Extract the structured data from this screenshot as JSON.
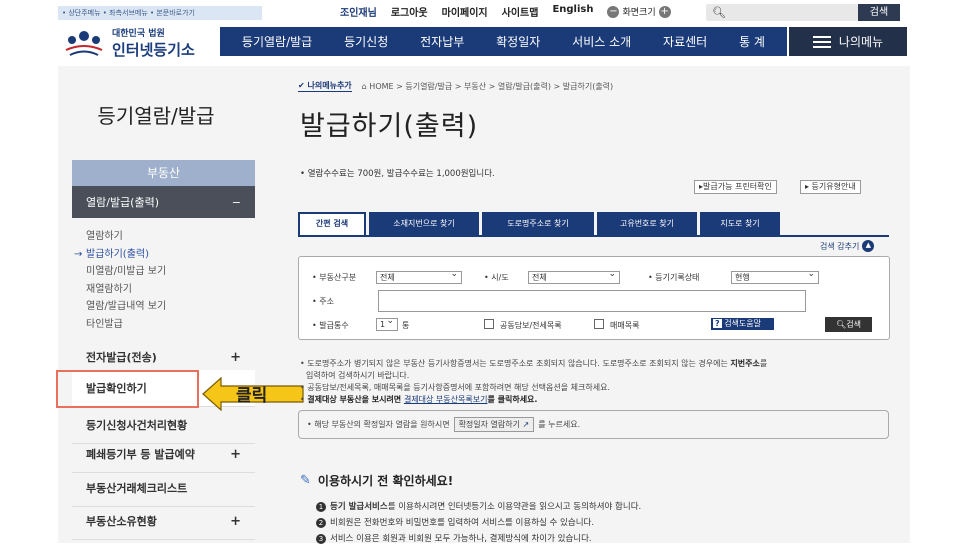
{
  "util": {
    "skip": "• 상단주메뉴 • 좌측서브메뉴 • 본문바로가기"
  },
  "toplinks": {
    "member": "조인재님",
    "logout": "로그아웃",
    "mypage": "마이페이지",
    "sitemap": "사이트맵",
    "english": "English",
    "zoom": "화면크기",
    "zoom_minus": "−",
    "zoom_plus": "+"
  },
  "search": {
    "button": "검색"
  },
  "logo": {
    "org": "대한민국 법원",
    "name": "인터넷등기소"
  },
  "gnb": [
    "등기열람/발급",
    "등기신청",
    "전자납부",
    "확정일자",
    "서비스 소개",
    "자료센터",
    "통 계"
  ],
  "mymenu": "나의메뉴",
  "left": {
    "title": "등기열람/발급",
    "section": "부동산",
    "active": "열람/발급(출력)",
    "active_toggle": "−",
    "subs": [
      "열람하기",
      "발급하기(출력)",
      "미열람/미발급 보기",
      "재열람하기",
      "열람/발급내역 보기",
      "타인발급"
    ],
    "items": [
      {
        "label": "전자발급(전송)",
        "plus": "+"
      },
      {
        "label": "발급확인하기",
        "plus": ""
      },
      {
        "label": "등기신청사건처리현황",
        "plus": ""
      },
      {
        "label": "폐쇄등기부 등 발급예약",
        "plus": "+"
      },
      {
        "label": "부동산거래체크리스트",
        "plus": ""
      },
      {
        "label": "부동산소유현황",
        "plus": "+"
      }
    ]
  },
  "click_label": "클릭",
  "crumb": {
    "fav": "나의메뉴추가",
    "path": "HOME > 등기열람/발급 > 부동산 > 열람/발급(출력) > 발급하기(출력)"
  },
  "page_title": "발급하기(출력)",
  "notice1": "• 열람수수료는 700원, 발급수수료는 1,000원입니다.",
  "btn_printer": "▸발급가능 프린터확인",
  "btn_type": "▸ 등기유형안내",
  "tabs": [
    "간편 검색",
    "소재지번으로 찾기",
    "도로명주소로 찾기",
    "고유번호로 찾기",
    "지도로 찾기"
  ],
  "collapse": "검색 감추기",
  "form": {
    "type_label": "• 부동산구분",
    "type_value": "전체",
    "sido_label": "• 시/도",
    "sido_value": "전체",
    "status_label": "• 등기기록상태",
    "status_value": "현행",
    "addr_label": "• 주소",
    "count_label": "• 발급통수",
    "count_value": "1",
    "count_unit": "통",
    "chk1": "공동담보/전세목록",
    "chk2": "매매목록",
    "help": "검색도움말",
    "search": "검색"
  },
  "notes": {
    "l1": "• 도로명주소가 병기되지 않은 부동산 등기사항증명서는 도로명주소로 조회되지 않습니다. 도로명주소로 조회되지 않는 경우에는 ",
    "l1b": "지번주소",
    "l1c": "를",
    "l2": "입력하여 검색하시기 바랍니다.",
    "l3": "• 공동담보/전세목록, 매매목록을 등기사항증명서에 포함하려면 해당 선택옵션을 체크하세요.",
    "l4a": "• ",
    "l4b": "결제대상 부동산을 보시려면 ",
    "l4c": "결제대상 부동산목록보기",
    "l4d": "를 클릭하세요."
  },
  "infobox": {
    "pre": "• 해당 부동산의 확정일자 열람을 원하시면",
    "btn": "확정일자 열람하기",
    "post": "를 누르세요."
  },
  "checkhead": "이용하시기 전 확인하세요!",
  "checklist": [
    {
      "n": "1",
      "b": "등기 발급서비스",
      "t": "를 이용하시려면 인터넷등기소 이용약관을 읽으시고 동의하셔야 합니다."
    },
    {
      "n": "2",
      "b": "",
      "t": "비회원은 전화번호와 비밀번호를 입력하여 서비스를 이용하실 수 있습니다."
    },
    {
      "n": "3",
      "b": "",
      "t": "서비스 이용은 회원과 비회원 모두 가능하나, 결제방식에 차이가 있습니다."
    }
  ],
  "colors": {
    "navy": "#1b3a78",
    "highlight": "#e8705c",
    "arrow": "#f5c518"
  }
}
